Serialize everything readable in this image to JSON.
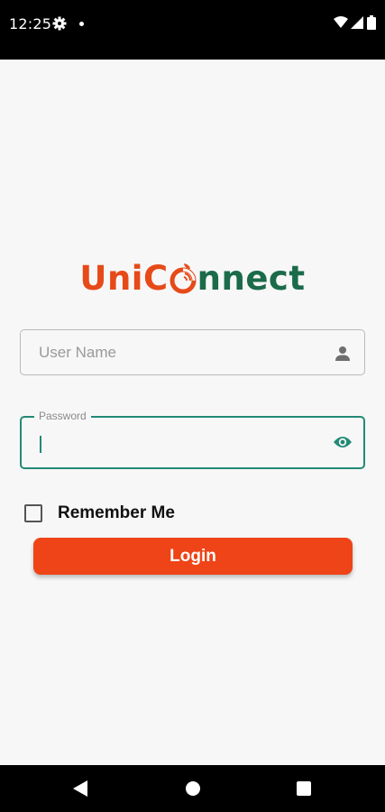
{
  "status_bar": {
    "time": "12:25",
    "icons": [
      "gear-icon",
      "dot-icon",
      "wifi-icon",
      "signal-icon",
      "battery-icon"
    ]
  },
  "logo": {
    "text_before_o": "Uni",
    "text_c": "C",
    "text_after_o": "nnect",
    "colors": {
      "primary": "#e64a19",
      "secondary": "#1b6b4a"
    }
  },
  "login_form": {
    "username": {
      "value": "",
      "placeholder": "User Name",
      "icon": "person-icon"
    },
    "password": {
      "label": "Password",
      "value": "",
      "icon": "eye-icon"
    },
    "remember_me": {
      "label": "Remember Me",
      "checked": false
    },
    "login_label": "Login"
  },
  "colors": {
    "accent": "#238a76",
    "button": "#ee4417",
    "background": "#f7f7f7"
  },
  "nav_bar": {
    "icons": [
      "back-icon",
      "home-icon",
      "recents-icon"
    ]
  }
}
